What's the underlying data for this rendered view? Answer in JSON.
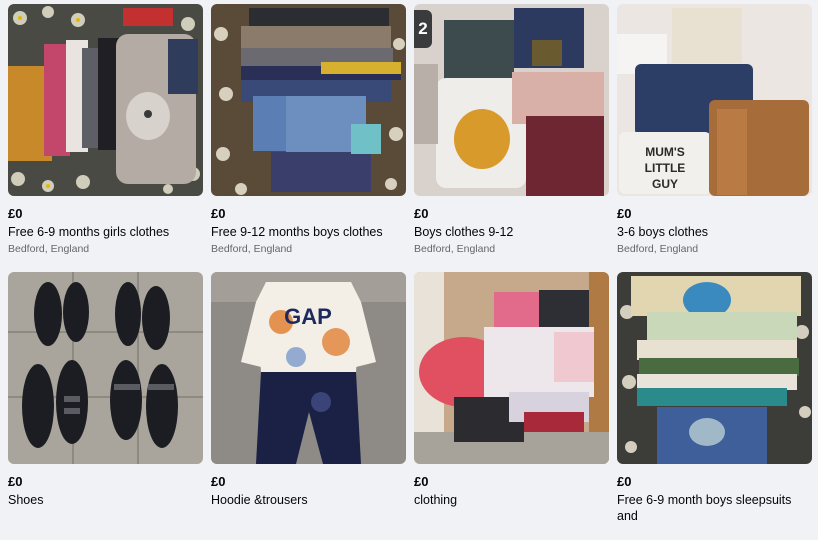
{
  "listings": [
    {
      "price": "£0",
      "title": "Free 6-9 months girls clothes",
      "location": "Bedford, England"
    },
    {
      "price": "£0",
      "title": "Free 9-12 months boys clothes",
      "location": "Bedford, England"
    },
    {
      "price": "£0",
      "title": "Boys clothes 9-12",
      "location": "Bedford, England",
      "badge": "2"
    },
    {
      "price": "£0",
      "title": "3-6 boys clothes",
      "location": "Bedford, England"
    },
    {
      "price": "£0",
      "title": "Shoes"
    },
    {
      "price": "£0",
      "title": "Hoodie &trousers"
    },
    {
      "price": "£0",
      "title": "clothing"
    },
    {
      "price": "£0",
      "title": "Free 6-9 month boys sleepsuits and"
    }
  ],
  "photo_text": {
    "gap": "GAP",
    "mums_little_guy": "MUM'S LITTLE GUY"
  }
}
